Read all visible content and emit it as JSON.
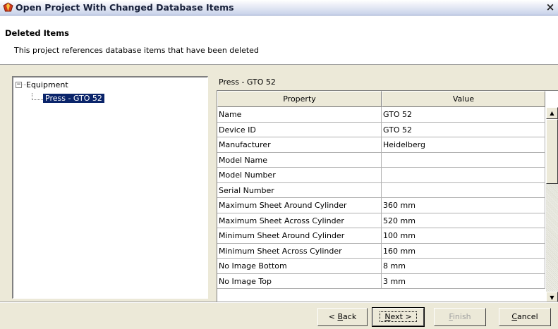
{
  "window": {
    "title": "Open Project With Changed Database Items",
    "close": "×"
  },
  "header": {
    "title": "Deleted Items",
    "description": "This project references database items that have been deleted"
  },
  "tree": {
    "root_label": "Equipment",
    "root_expander": "−",
    "child_label": "Press - GTO 52"
  },
  "details": {
    "title": "Press - GTO 52",
    "columns": [
      "Property",
      "Value"
    ],
    "rows": [
      {
        "property": "Name",
        "value": "GTO 52"
      },
      {
        "property": "Device ID",
        "value": "GTO 52"
      },
      {
        "property": "Manufacturer",
        "value": "Heidelberg"
      },
      {
        "property": "Model Name",
        "value": ""
      },
      {
        "property": "Model Number",
        "value": ""
      },
      {
        "property": "Serial Number",
        "value": ""
      },
      {
        "property": "Maximum Sheet Around Cylinder",
        "value": "360 mm"
      },
      {
        "property": "Maximum Sheet Across Cylinder",
        "value": "520 mm"
      },
      {
        "property": "Minimum Sheet Around Cylinder",
        "value": "100 mm"
      },
      {
        "property": "Minimum Sheet Across Cylinder",
        "value": "160 mm"
      },
      {
        "property": "No Image Bottom",
        "value": "8 mm"
      },
      {
        "property": "No Image Top",
        "value": "3 mm"
      }
    ]
  },
  "buttons": {
    "back": {
      "mnemonic": "B",
      "rest": "ack",
      "prefix": "< "
    },
    "next": {
      "mnemonic": "N",
      "rest": "ext >"
    },
    "finish": {
      "mnemonic": "F",
      "rest": "inish"
    },
    "cancel": {
      "mnemonic": "C",
      "rest": "ancel"
    }
  },
  "icons": {
    "app": "gem-icon",
    "scroll_up": "▲",
    "scroll_down": "▼"
  },
  "colors": {
    "selection": "#0a246a",
    "face": "#ece9d8"
  }
}
